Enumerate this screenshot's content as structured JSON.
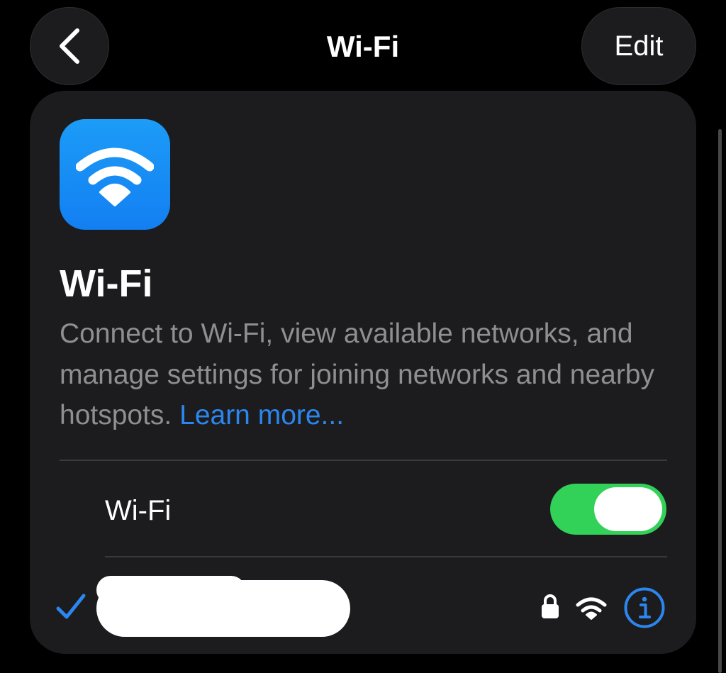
{
  "nav": {
    "title": "Wi-Fi",
    "edit_label": "Edit",
    "back_icon": "chevron-left-icon"
  },
  "header": {
    "app_icon": "wifi-icon",
    "title": "Wi-Fi",
    "description": "Connect to Wi-Fi, view available networks, and manage settings for joining networks and nearby hotspots.",
    "learn_more": "Learn more..."
  },
  "wifi_toggle": {
    "label": "Wi-Fi",
    "state": "on"
  },
  "connected_network": {
    "name_redacted": true,
    "connected": true,
    "secured": true,
    "icons": [
      "checkmark-icon",
      "lock-icon",
      "wifi-signal-icon",
      "info-icon"
    ]
  },
  "colors": {
    "background": "#000000",
    "card": "#1c1c1e",
    "accent_blue": "#2b87ef",
    "toggle_green": "#32d158",
    "secondary_text": "#8e8e93",
    "separator": "#3a3a3c"
  }
}
